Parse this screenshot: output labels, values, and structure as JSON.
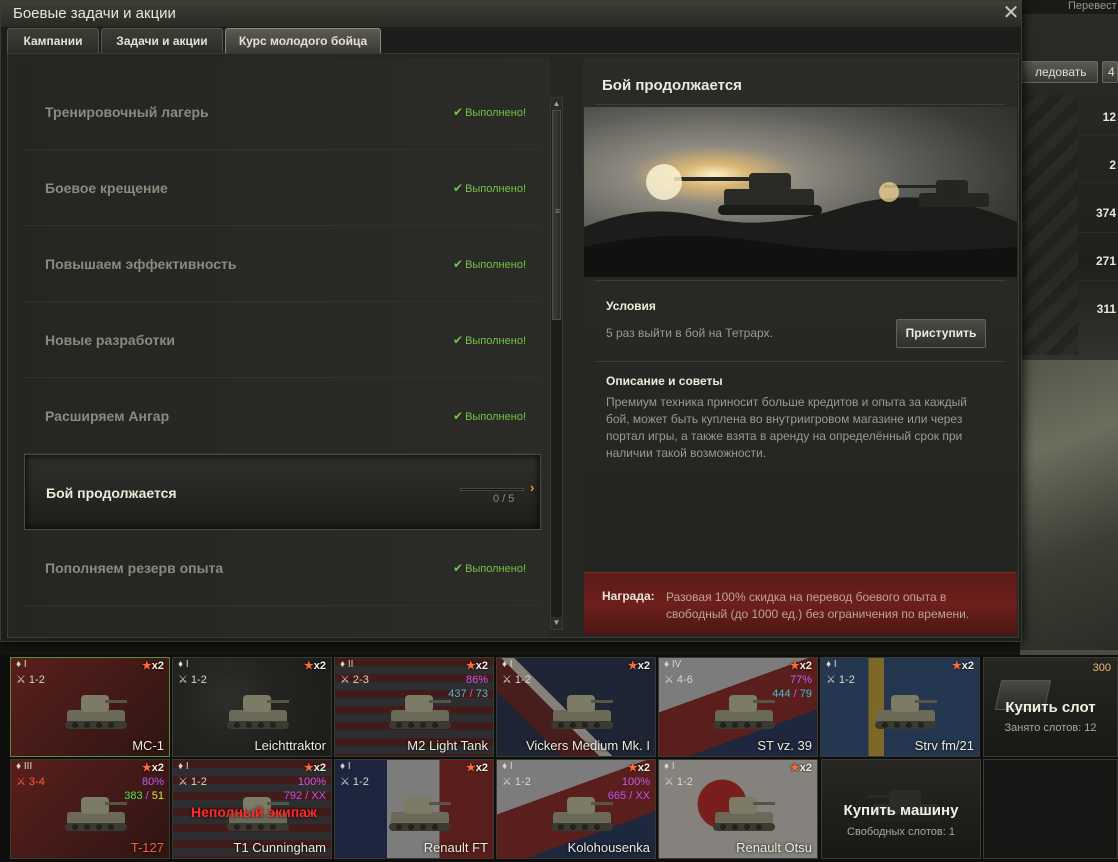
{
  "background": {
    "top_text": "Перевест",
    "buttons": [
      "ледовать",
      "4"
    ],
    "numbers": [
      "12",
      "2",
      "374",
      "271",
      "311"
    ]
  },
  "window": {
    "title": "Боевые задачи и акции",
    "close_label": "✕",
    "tabs": [
      "Кампании",
      "Задачи и акции",
      "Курс молодого бойца"
    ],
    "active_tab": 2
  },
  "quests": [
    {
      "name": "Тренировочный лагерь",
      "status": "Выполнено!"
    },
    {
      "name": "Боевое крещение",
      "status": "Выполнено!"
    },
    {
      "name": "Повышаем эффективность",
      "status": "Выполнено!"
    },
    {
      "name": "Новые разработки",
      "status": "Выполнено!"
    },
    {
      "name": "Расширяем Ангар",
      "status": "Выполнено!"
    },
    {
      "name": "Бой продолжается",
      "progress_text": "0 / 5",
      "progress": 0
    },
    {
      "name": "Пополняем резерв опыта",
      "status": "Выполнено!"
    }
  ],
  "detail": {
    "title": "Бой продолжается",
    "conditions_header": "Условия",
    "conditions_text": "5 раз выйти в бой на Тетрарх.",
    "start_button": "Приступить",
    "description_header": "Описание и советы",
    "description_text": "Премиум техника приносит больше кредитов и опыта за каждый бой, может быть куплена во внутриигровом магазине или через портал игры, а также взята в аренду на определённый срок при наличии такой возможности.",
    "reward_label": "Награда:",
    "reward_text": "Разовая 100% скидка на перевод боевого опыта в свободный (до 1000 ед.) без ограничения по времени."
  },
  "carousel": {
    "row1": [
      {
        "name": "МС-1",
        "tier": "I",
        "levels": "1-2",
        "xp": "x2",
        "flag": "ussr",
        "selected": true
      },
      {
        "name": "Leichttraktor",
        "tier": "I",
        "levels": "1-2",
        "xp": "x2",
        "flag": "germany"
      },
      {
        "name": "M2 Light Tank",
        "tier": "II",
        "levels": "2-3",
        "xp": "x2",
        "flag": "usa",
        "pct": "86%",
        "xp_a": "437",
        "xp_b": "73"
      },
      {
        "name": "Vickers Medium Mk. I",
        "tier": "I",
        "levels": "1-2",
        "xp": "x2",
        "flag": "uk"
      },
      {
        "name": "ST vz. 39",
        "tier": "IV",
        "levels": "4-6",
        "xp": "x2",
        "flag": "czech",
        "pct": "77%",
        "xp_a": "444",
        "xp_b": "79"
      },
      {
        "name": "Strv fm/21",
        "tier": "I",
        "levels": "1-2",
        "xp": "x2",
        "flag": "sweden"
      }
    ],
    "row2": [
      {
        "name": "T-127",
        "tier": "III",
        "levels": "3-4",
        "xp": "x2",
        "flag": "ussr",
        "pct": "80%",
        "xp_a": "383",
        "xp_b": "51",
        "red": true
      },
      {
        "name": "T1 Cunningham",
        "tier": "I",
        "levels": "1-2",
        "xp": "x2",
        "flag": "usa",
        "pct": "100%",
        "xp_a": "792",
        "xp_b": "XX",
        "crew": "Неполный экипаж"
      },
      {
        "name": "Renault FT",
        "tier": "I",
        "levels": "1-2",
        "xp": "x2",
        "flag": "france"
      },
      {
        "name": "Kolohousenka",
        "tier": "I",
        "levels": "1-2",
        "xp": "x2",
        "flag": "czech",
        "pct": "100%",
        "xp_a": "665",
        "xp_b": "XX"
      },
      {
        "name": "Renault Otsu",
        "tier": "I",
        "levels": "1-2",
        "xp": "x2",
        "flag": "japan"
      }
    ],
    "buy_slot": {
      "title": "Купить слот",
      "sub": "Занято слотов: 12",
      "price": "300"
    },
    "buy_tank": {
      "title": "Купить машину",
      "sub": "Свободных слотов: 1"
    }
  },
  "colors": {
    "accent": "#e3a32c",
    "done": "#74c346",
    "reward": "#6e1f1c"
  }
}
